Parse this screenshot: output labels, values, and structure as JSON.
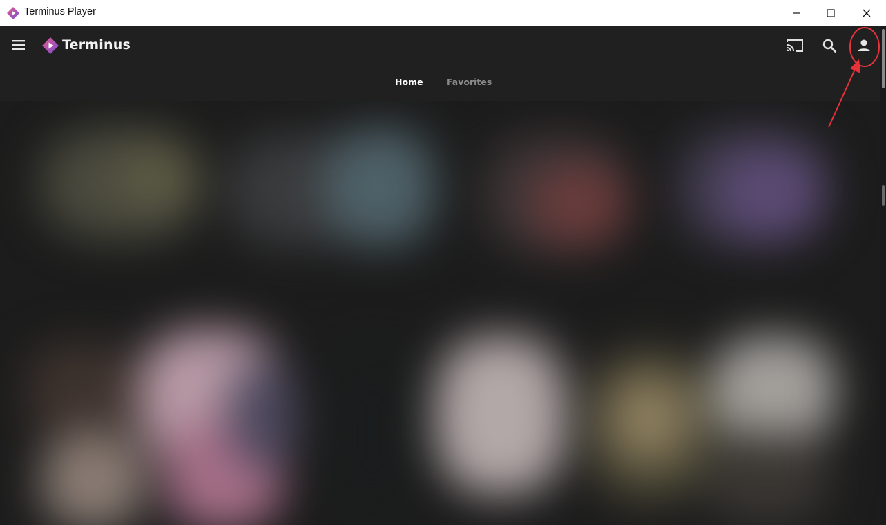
{
  "window": {
    "title": "Terminus Player",
    "controls": {
      "minimize": "minimize-icon",
      "maximize": "maximize-icon",
      "close": "close-icon"
    }
  },
  "header": {
    "menu_icon": "hamburger-menu-icon",
    "logo_text": "Terminus",
    "cast_icon": "cast-icon",
    "search_icon": "search-icon",
    "profile_icon": "user-profile-icon"
  },
  "tabs": [
    {
      "label": "Home",
      "active": true
    },
    {
      "label": "Favorites",
      "active": false
    }
  ],
  "colors": {
    "brand_pink": "#d64a8a",
    "brand_purple": "#7b4fd1",
    "annotation_red": "#e8323a",
    "background": "#202020"
  }
}
